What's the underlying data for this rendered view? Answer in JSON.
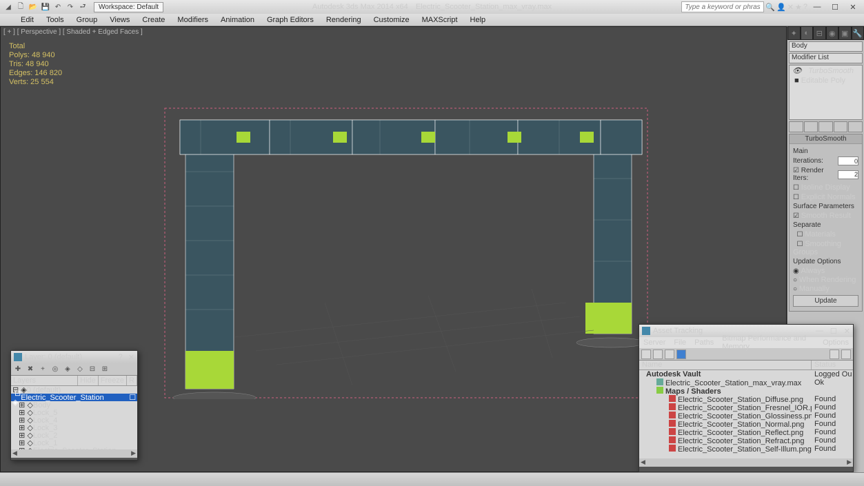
{
  "title": {
    "app": "Autodesk 3ds Max 2014 x64",
    "file": "Electric_Scooter_Station_max_vray.max"
  },
  "workspace": "Workspace: Default",
  "search_placeholder": "Type a keyword or phrase",
  "menus": [
    "Edit",
    "Tools",
    "Group",
    "Views",
    "Create",
    "Modifiers",
    "Animation",
    "Graph Editors",
    "Rendering",
    "Customize",
    "MAXScript",
    "Help"
  ],
  "viewport": {
    "label": "[ + ] [ Perspective ] [ Shaded + Edged Faces ]"
  },
  "stats": {
    "total": "Total",
    "polys": "Polys:   48 940",
    "tris": "Tris:     48 940",
    "edges": "Edges:  146 820",
    "verts": "Verts:   25 554"
  },
  "cmd": {
    "object_name": "Body",
    "modlist": "Modifier List",
    "stack": [
      "TurboSmooth",
      "Editable Poly"
    ],
    "rollout1": {
      "title": "TurboSmooth",
      "main": "Main",
      "iter": "Iterations:",
      "iter_v": "0",
      "rend": "Render Iters:",
      "rend_v": "2",
      "iso": "Isoline Display",
      "exp": "Explicit Normals",
      "surf": "Surface Parameters",
      "smooth": "Smooth Result",
      "sep": "Separate",
      "mat": "Materials",
      "sg": "Smoothing Groups",
      "upd": "Update Options",
      "always": "Always",
      "when": "When Rendering",
      "man": "Manually",
      "btn": "Update"
    }
  },
  "layer": {
    "title": "Layer: 0 (default)",
    "cols": {
      "layers": "Layers",
      "hide": "Hide",
      "freeze": "Freeze",
      "r": "R"
    },
    "items": [
      "0 (default)",
      "Electric_Scooter_Station",
      "Body",
      "Lock_5",
      "Lock_4",
      "Lock_3",
      "Lock_2",
      "Lock_1",
      "Electric_Scooter_Station"
    ]
  },
  "asset": {
    "title": "Asset Tracking",
    "menus": [
      "Server",
      "File",
      "Paths",
      "Bitmap Performance and Memory",
      "Options"
    ],
    "cols": {
      "name": "Name",
      "status": "Status"
    },
    "rows": [
      {
        "name": "Autodesk Vault",
        "status": "Logged Ou",
        "bold": true,
        "indent": 10
      },
      {
        "name": "Electric_Scooter_Station_max_vray.max",
        "status": "Ok",
        "indent": 22,
        "ico": "#6a9"
      },
      {
        "name": "Maps / Shaders",
        "status": "",
        "bold": true,
        "indent": 22,
        "ico": "#8c4"
      },
      {
        "name": "Electric_Scooter_Station_Diffuse.png",
        "status": "Found",
        "indent": 40,
        "ico": "#c44"
      },
      {
        "name": "Electric_Scooter_Station_Fresnel_IOR.png",
        "status": "Found",
        "indent": 40,
        "ico": "#c44"
      },
      {
        "name": "Electric_Scooter_Station_Glossiness.png",
        "status": "Found",
        "indent": 40,
        "ico": "#c44"
      },
      {
        "name": "Electric_Scooter_Station_Normal.png",
        "status": "Found",
        "indent": 40,
        "ico": "#c44"
      },
      {
        "name": "Electric_Scooter_Station_Reflect.png",
        "status": "Found",
        "indent": 40,
        "ico": "#c44"
      },
      {
        "name": "Electric_Scooter_Station_Refract.png",
        "status": "Found",
        "indent": 40,
        "ico": "#c44"
      },
      {
        "name": "Electric_Scooter_Station_Self-Illum.png",
        "status": "Found",
        "indent": 40,
        "ico": "#c44"
      }
    ]
  }
}
